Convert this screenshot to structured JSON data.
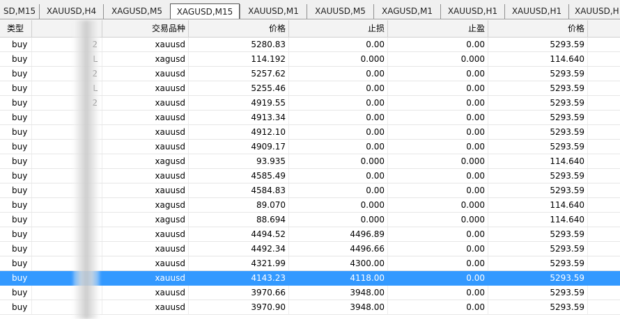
{
  "tabs": [
    {
      "label": "SD,M15",
      "active": false
    },
    {
      "label": "XAUUSD,H4",
      "active": false
    },
    {
      "label": "XAGUSD,M5",
      "active": false
    },
    {
      "label": "XAGUSD,M15",
      "active": true
    },
    {
      "label": "XAUUSD,M1",
      "active": false
    },
    {
      "label": "XAUUSD,M5",
      "active": false
    },
    {
      "label": "XAGUSD,M1",
      "active": false
    },
    {
      "label": "XAUUSD,H1",
      "active": false
    },
    {
      "label": "XAUUSD,H1",
      "active": false
    },
    {
      "label": "XAUUSD,H",
      "active": false
    }
  ],
  "columns": {
    "type": "类型",
    "id": "",
    "symbol": "交易品种",
    "price": "价格",
    "stop_loss": "止损",
    "take_profit": "止盈",
    "current_price": "价格"
  },
  "rows": [
    {
      "type": "buy",
      "id": "2",
      "symbol": "xauusd",
      "price": "5280.83",
      "sl": "0.00",
      "tp": "0.00",
      "cur": "5293.59"
    },
    {
      "type": "buy",
      "id": "L",
      "symbol": "xagusd",
      "price": "114.192",
      "sl": "0.000",
      "tp": "0.000",
      "cur": "114.640"
    },
    {
      "type": "buy",
      "id": "2",
      "symbol": "xauusd",
      "price": "5257.62",
      "sl": "0.00",
      "tp": "0.00",
      "cur": "5293.59"
    },
    {
      "type": "buy",
      "id": "L",
      "symbol": "xauusd",
      "price": "5255.46",
      "sl": "0.00",
      "tp": "0.00",
      "cur": "5293.59"
    },
    {
      "type": "buy",
      "id": "2",
      "symbol": "xauusd",
      "price": "4919.55",
      "sl": "0.00",
      "tp": "0.00",
      "cur": "5293.59"
    },
    {
      "type": "buy",
      "id": "",
      "symbol": "xauusd",
      "price": "4913.34",
      "sl": "0.00",
      "tp": "0.00",
      "cur": "5293.59"
    },
    {
      "type": "buy",
      "id": "",
      "symbol": "xauusd",
      "price": "4912.10",
      "sl": "0.00",
      "tp": "0.00",
      "cur": "5293.59"
    },
    {
      "type": "buy",
      "id": "",
      "symbol": "xauusd",
      "price": "4909.17",
      "sl": "0.00",
      "tp": "0.00",
      "cur": "5293.59"
    },
    {
      "type": "buy",
      "id": "",
      "symbol": "xagusd",
      "price": "93.935",
      "sl": "0.000",
      "tp": "0.000",
      "cur": "114.640"
    },
    {
      "type": "buy",
      "id": "",
      "symbol": "xauusd",
      "price": "4585.49",
      "sl": "0.00",
      "tp": "0.00",
      "cur": "5293.59"
    },
    {
      "type": "buy",
      "id": "",
      "symbol": "xauusd",
      "price": "4584.83",
      "sl": "0.00",
      "tp": "0.00",
      "cur": "5293.59"
    },
    {
      "type": "buy",
      "id": "",
      "symbol": "xagusd",
      "price": "89.070",
      "sl": "0.000",
      "tp": "0.000",
      "cur": "114.640"
    },
    {
      "type": "buy",
      "id": "",
      "symbol": "xagusd",
      "price": "88.694",
      "sl": "0.000",
      "tp": "0.000",
      "cur": "114.640"
    },
    {
      "type": "buy",
      "id": "",
      "symbol": "xauusd",
      "price": "4494.52",
      "sl": "4496.89",
      "tp": "0.00",
      "cur": "5293.59"
    },
    {
      "type": "buy",
      "id": "",
      "symbol": "xauusd",
      "price": "4492.34",
      "sl": "4496.66",
      "tp": "0.00",
      "cur": "5293.59"
    },
    {
      "type": "buy",
      "id": "",
      "symbol": "xauusd",
      "price": "4321.99",
      "sl": "4300.00",
      "tp": "0.00",
      "cur": "5293.59"
    },
    {
      "type": "buy",
      "id": "",
      "symbol": "xauusd",
      "price": "4143.23",
      "sl": "4118.00",
      "tp": "0.00",
      "cur": "5293.59",
      "selected": true
    },
    {
      "type": "buy",
      "id": "",
      "symbol": "xauusd",
      "price": "3970.66",
      "sl": "3948.00",
      "tp": "0.00",
      "cur": "5293.59"
    },
    {
      "type": "buy",
      "id": "",
      "symbol": "xauusd",
      "price": "3970.90",
      "sl": "3948.00",
      "tp": "0.00",
      "cur": "5293.59"
    }
  ],
  "colors": {
    "selection": "#3399ff",
    "header_bg": "#f3f3f3",
    "tabbar_bg": "#f0f0f0"
  }
}
